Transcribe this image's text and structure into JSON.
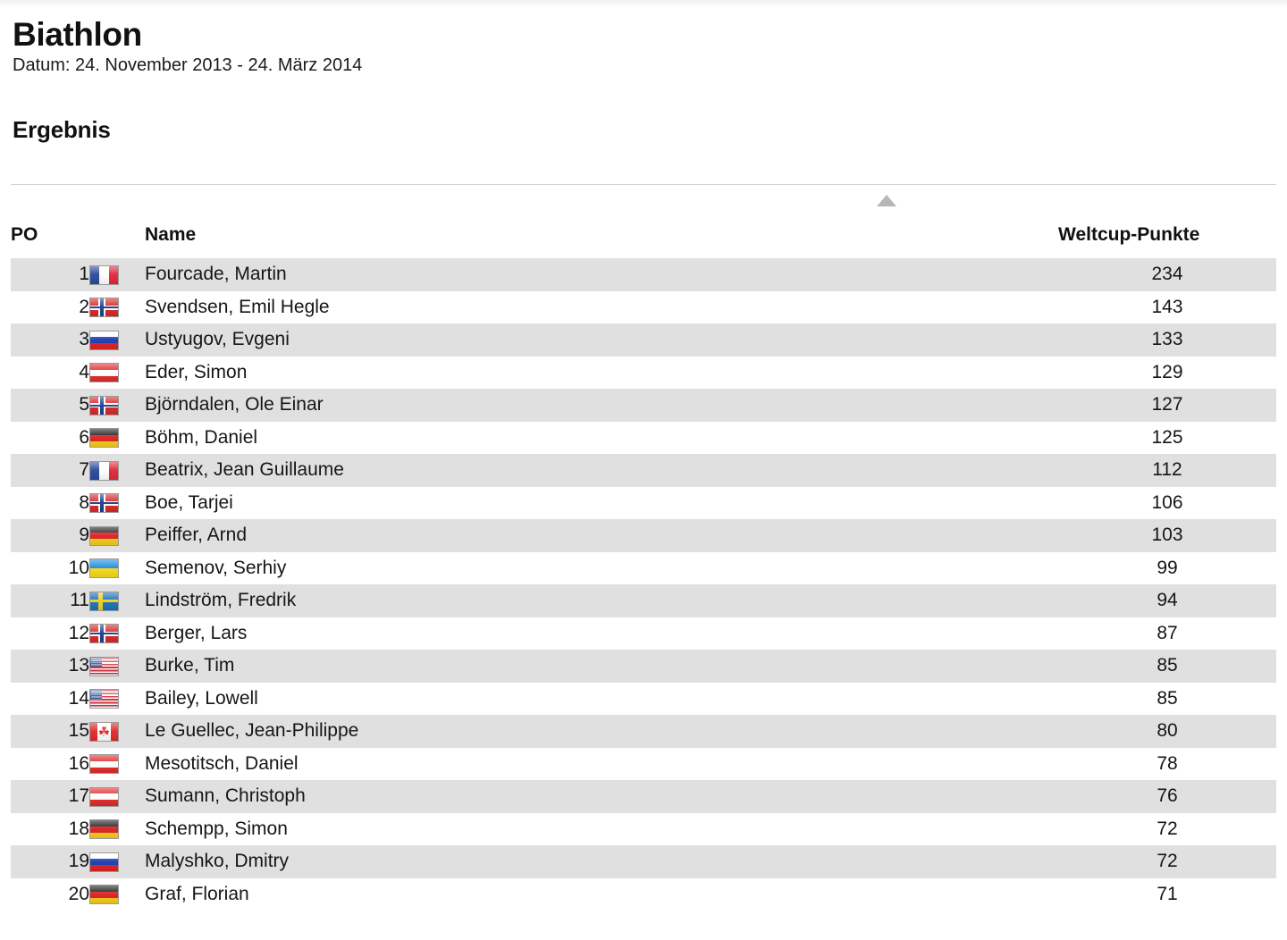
{
  "header": {
    "title": "Biathlon",
    "subtitle": "Datum: 24. November 2013 - 24. März 2014",
    "section_title": "Ergebnis"
  },
  "sort": {
    "indicator": "sort-ascending-triangle",
    "color": "#b7b7b7"
  },
  "table": {
    "columns": {
      "position": "PO",
      "name": "Name",
      "points": "Weltcup-Punkte"
    },
    "rows": [
      {
        "position": "1",
        "flag": "fr",
        "flag_name": "flag-france",
        "name": "Fourcade, Martin",
        "points": "234"
      },
      {
        "position": "2",
        "flag": "no",
        "flag_name": "flag-norway",
        "name": "Svendsen, Emil Hegle",
        "points": "143"
      },
      {
        "position": "3",
        "flag": "ru",
        "flag_name": "flag-russia",
        "name": "Ustyugov, Evgeni",
        "points": "133"
      },
      {
        "position": "4",
        "flag": "at",
        "flag_name": "flag-austria",
        "name": "Eder, Simon",
        "points": "129"
      },
      {
        "position": "5",
        "flag": "no",
        "flag_name": "flag-norway",
        "name": "Björndalen, Ole Einar",
        "points": "127"
      },
      {
        "position": "6",
        "flag": "de",
        "flag_name": "flag-germany",
        "name": "Böhm, Daniel",
        "points": "125"
      },
      {
        "position": "7",
        "flag": "fr",
        "flag_name": "flag-france",
        "name": "Beatrix, Jean Guillaume",
        "points": "112"
      },
      {
        "position": "8",
        "flag": "no",
        "flag_name": "flag-norway",
        "name": "Boe, Tarjei",
        "points": "106"
      },
      {
        "position": "9",
        "flag": "de",
        "flag_name": "flag-germany",
        "name": "Peiffer, Arnd",
        "points": "103"
      },
      {
        "position": "10",
        "flag": "ua",
        "flag_name": "flag-ukraine",
        "name": "Semenov, Serhiy",
        "points": "99"
      },
      {
        "position": "11",
        "flag": "se",
        "flag_name": "flag-sweden",
        "name": "Lindström, Fredrik",
        "points": "94"
      },
      {
        "position": "12",
        "flag": "no",
        "flag_name": "flag-norway",
        "name": "Berger, Lars",
        "points": "87"
      },
      {
        "position": "13",
        "flag": "us",
        "flag_name": "flag-united-states",
        "name": "Burke, Tim",
        "points": "85"
      },
      {
        "position": "14",
        "flag": "us",
        "flag_name": "flag-united-states",
        "name": "Bailey, Lowell",
        "points": "85"
      },
      {
        "position": "15",
        "flag": "ca",
        "flag_name": "flag-canada",
        "name": "Le Guellec, Jean-Philippe",
        "points": "80"
      },
      {
        "position": "16",
        "flag": "at",
        "flag_name": "flag-austria",
        "name": "Mesotitsch, Daniel",
        "points": "78"
      },
      {
        "position": "17",
        "flag": "at",
        "flag_name": "flag-austria",
        "name": "Sumann, Christoph",
        "points": "76"
      },
      {
        "position": "18",
        "flag": "de",
        "flag_name": "flag-germany",
        "name": "Schempp, Simon",
        "points": "72"
      },
      {
        "position": "19",
        "flag": "ru",
        "flag_name": "flag-russia",
        "name": "Malyshko, Dmitry",
        "points": "72"
      },
      {
        "position": "20",
        "flag": "de",
        "flag_name": "flag-germany",
        "name": "Graf, Florian",
        "points": "71"
      }
    ]
  }
}
